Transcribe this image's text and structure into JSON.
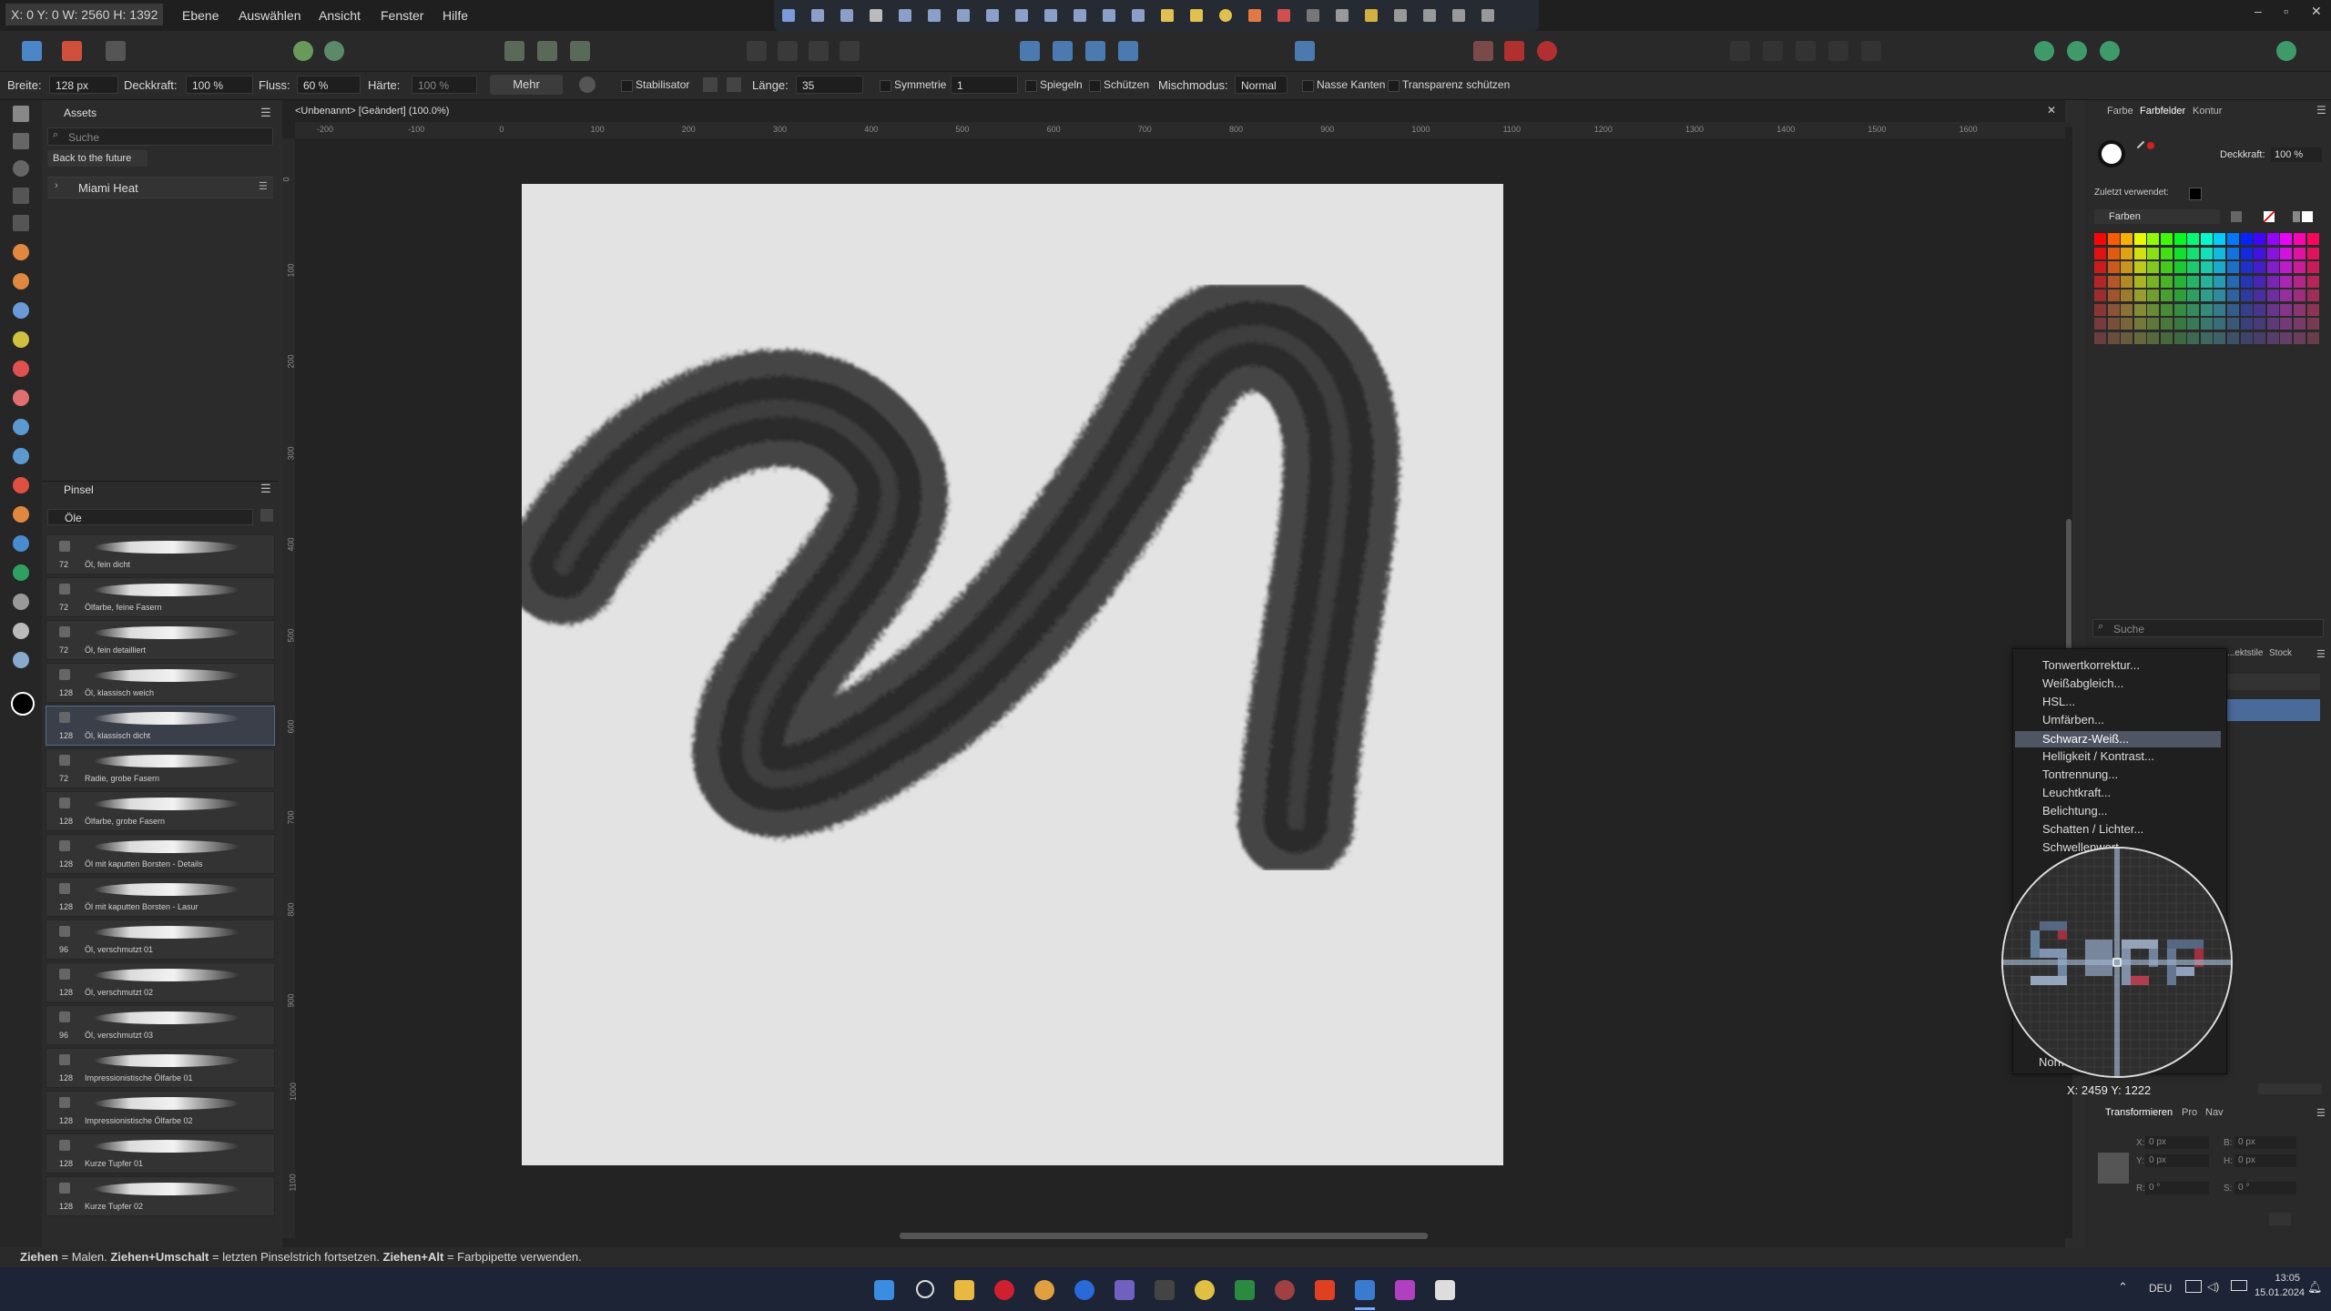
{
  "menubar": {
    "coords": "X: 0 Y: 0 W: 2560 H: 1392",
    "items": [
      "Ebene",
      "Auswählen",
      "Ansicht",
      "Fenster",
      "Hilfe"
    ]
  },
  "context_bar": {
    "breite_label": "Breite:",
    "breite_value": "128 px",
    "deckkraft_label": "Deckkraft:",
    "deckkraft_value": "100 %",
    "fluss_label": "Fluss:",
    "fluss_value": "60 %",
    "haerte_label": "Härte:",
    "haerte_value": "100 %",
    "mehr": "Mehr",
    "stabilisator": "Stabilisator",
    "laenge_label": "Länge:",
    "laenge_value": "35",
    "symmetrie": "Symmetrie",
    "symmetrie_value": "1",
    "spiegeln": "Spiegeln",
    "schuetzen": "Schützen",
    "mischmodus_label": "Mischmodus:",
    "mischmodus_value": "Normal",
    "nasse_kanten": "Nasse Kanten",
    "transparenz": "Transparenz schützen"
  },
  "assets_panel": {
    "tab": "Assets",
    "search_placeholder": "Suche",
    "dropdown": "Back to the future",
    "category": "Miami Heat"
  },
  "brushes_panel": {
    "tab": "Pinsel",
    "category": "Öle",
    "brushes": [
      {
        "size": "72",
        "name": "Öl, fein dicht"
      },
      {
        "size": "72",
        "name": "Ölfarbe, feine Fasern"
      },
      {
        "size": "72",
        "name": "Öl, fein detailliert"
      },
      {
        "size": "128",
        "name": "Öl, klassisch weich"
      },
      {
        "size": "128",
        "name": "Öl, klassisch dicht"
      },
      {
        "size": "72",
        "name": "Radie, grobe Fasern"
      },
      {
        "size": "128",
        "name": "Ölfarbe, grobe Fasern"
      },
      {
        "size": "128",
        "name": "Öl mit kaputten Borsten - Details"
      },
      {
        "size": "128",
        "name": "Öl mit kaputten Borsten - Lasur"
      },
      {
        "size": "96",
        "name": "Öl, verschmutzt 01"
      },
      {
        "size": "128",
        "name": "Öl, verschmutzt 02"
      },
      {
        "size": "96",
        "name": "Öl, verschmutzt 03"
      },
      {
        "size": "128",
        "name": "Impressionistische Ölfarbe 01"
      },
      {
        "size": "128",
        "name": "Impressionistische Ölfarbe 02"
      },
      {
        "size": "128",
        "name": "Kurze Tupfer 01"
      },
      {
        "size": "128",
        "name": "Kurze Tupfer 02"
      }
    ],
    "selected_index": 4
  },
  "document": {
    "title": "<Unbenannt> [Geändert] (100.0%)",
    "ruler_h": [
      "-200",
      "-100",
      "0",
      "100",
      "200",
      "300",
      "400",
      "500",
      "600",
      "700",
      "800",
      "900",
      "1000",
      "1100",
      "1200",
      "1300",
      "1400",
      "1500",
      "1600"
    ],
    "ruler_v": [
      "0",
      "100",
      "200",
      "300",
      "400",
      "500",
      "600",
      "700",
      "800",
      "900",
      "1000",
      "1100",
      "1200"
    ]
  },
  "right_panel": {
    "tabs": [
      "Farbe",
      "Farbfelder",
      "Kontur"
    ],
    "deckkraft_label": "Deckkraft:",
    "deckkraft_value": "100 %",
    "recent_label": "Zuletzt verwendet:",
    "palette": "Farben",
    "search_placeholder": "Suche",
    "lower_tabs": [
      "...ektstile",
      "Stock"
    ],
    "transform_tabs": [
      "Transformieren",
      "Pro",
      "Nav"
    ],
    "fields": {
      "x": "0 px",
      "y": "0 px",
      "b": "0 px",
      "h": "0 px",
      "r": "0 °",
      "s": "0 °"
    }
  },
  "context_menu": {
    "items": [
      "Tonwertkorrektur...",
      "Weißabgleich...",
      "HSL...",
      "Umfärben...",
      "Schwarz-Weiß...",
      "Helligkeit / Kontrast...",
      "Tontrennung...",
      "Leuchtkraft...",
      "Belichtung...",
      "Schatten / Lichter...",
      "Schwellenwert..."
    ],
    "highlighted": "Schwarz-Weiß...",
    "bottom_item": "Norm..."
  },
  "loupe_coords": "X: 2459 Y: 1222",
  "status_bar": {
    "b1": "Ziehen",
    "t1": " = Malen. ",
    "b2": "Ziehen+Umschalt",
    "t2": " = letzten Pinselstrich fortsetzen. ",
    "b3": "Ziehen+Alt",
    "t3": " = Farbpipette verwenden."
  },
  "taskbar": {
    "lang": "DEU",
    "time": "13:05",
    "date": "15.01.2024"
  },
  "colors": {
    "accent": "#5b8fd8",
    "canvas": "#e3e3e3",
    "stroke": "#1f1f1f"
  }
}
